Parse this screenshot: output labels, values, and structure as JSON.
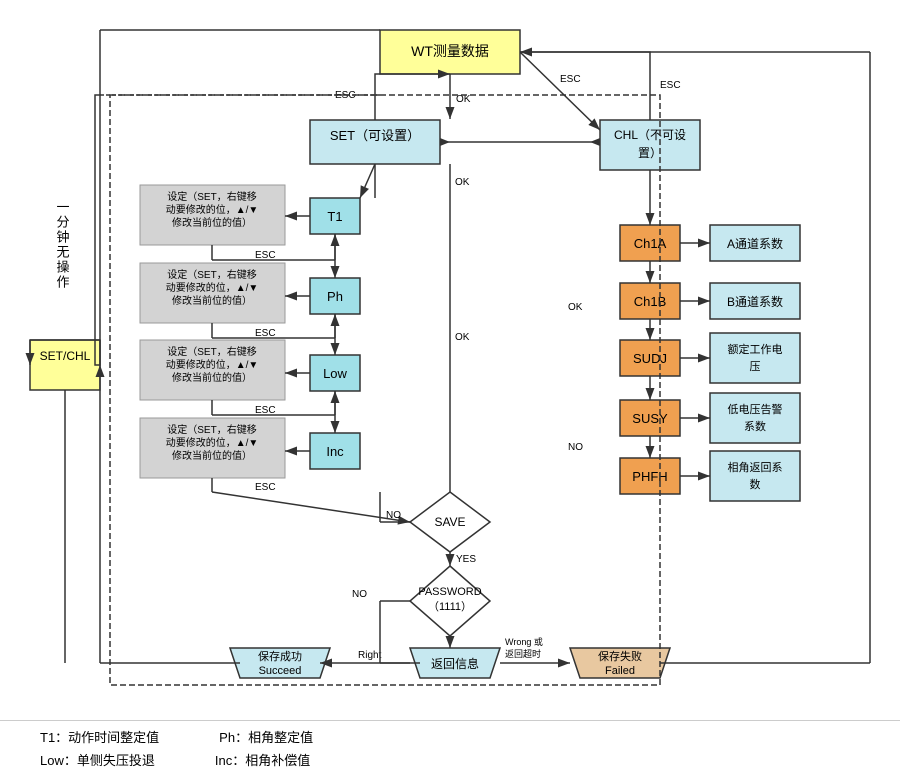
{
  "legend": {
    "row1": [
      {
        "label": "T1：动作时间整定值"
      },
      {
        "label": "Ph：相角整定值"
      }
    ],
    "row2": [
      {
        "label": "Low：单侧失压投退"
      },
      {
        "label": "Inc：相角补偿值"
      }
    ]
  }
}
